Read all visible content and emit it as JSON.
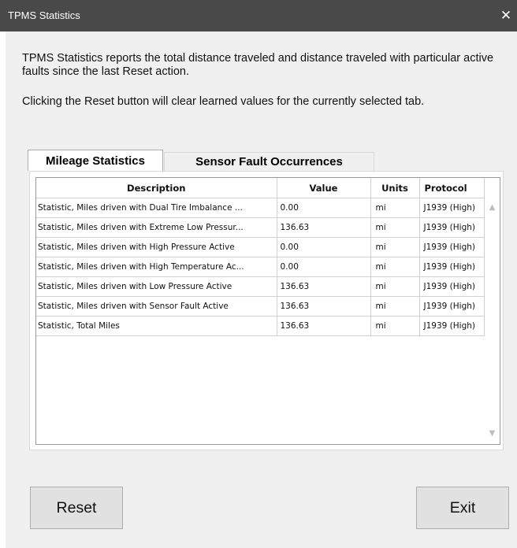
{
  "window": {
    "title": "TPMS Statistics",
    "close_glyph": "✕"
  },
  "description": {
    "line1": "TPMS Statistics reports the total distance traveled and distance traveled with particular active faults since the last Reset action.",
    "line2": "Clicking the Reset button will clear learned values for the currently selected tab."
  },
  "tabs": [
    {
      "label": "Mileage Statistics",
      "selected": true
    },
    {
      "label": "Sensor Fault Occurrences",
      "selected": false
    }
  ],
  "table": {
    "columns": [
      "Description",
      "Value",
      "Units",
      "Protocol"
    ],
    "rows": [
      {
        "description": "Statistic, Miles driven with Dual Tire Imbalance ...",
        "value": "0.00",
        "units": "mi",
        "protocol": "J1939 (High)"
      },
      {
        "description": "Statistic, Miles driven with Extreme Low Pressur...",
        "value": "136.63",
        "units": "mi",
        "protocol": "J1939 (High)"
      },
      {
        "description": "Statistic, Miles driven with High Pressure Active",
        "value": "0.00",
        "units": "mi",
        "protocol": "J1939 (High)"
      },
      {
        "description": "Statistic, Miles driven with High Temperature Ac...",
        "value": "0.00",
        "units": "mi",
        "protocol": "J1939 (High)"
      },
      {
        "description": "Statistic, Miles driven with Low Pressure Active",
        "value": "136.63",
        "units": "mi",
        "protocol": "J1939 (High)"
      },
      {
        "description": "Statistic, Miles driven with Sensor Fault Active",
        "value": "136.63",
        "units": "mi",
        "protocol": "J1939 (High)"
      },
      {
        "description": "Statistic, Total Miles",
        "value": "136.63",
        "units": "mi",
        "protocol": "J1939 (High)"
      }
    ]
  },
  "scrollbar": {
    "up_icon": "chevron-up-icon",
    "down_icon": "chevron-down-icon"
  },
  "buttons": {
    "reset_label": "Reset",
    "exit_label": "Exit"
  },
  "colors": {
    "titlebar": "#494949",
    "client_background": "#f0f0f0",
    "button_face": "#e1e1e1"
  }
}
